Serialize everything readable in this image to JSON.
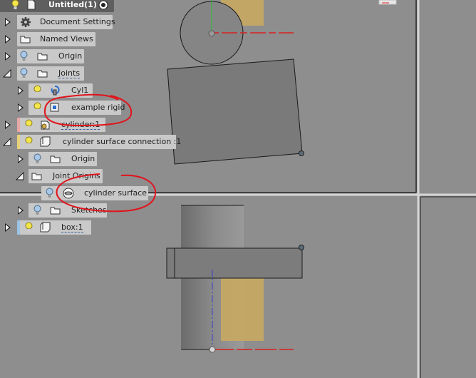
{
  "browser": {
    "root": {
      "label": "Untitled(1)"
    },
    "items": [
      {
        "label": "Document Settings"
      },
      {
        "label": "Named Views"
      },
      {
        "label": "Origin"
      },
      {
        "label": "Joints"
      },
      {
        "label": "Cyl1"
      },
      {
        "label": "example rigid"
      },
      {
        "label": "cylinder:1"
      },
      {
        "label": "cylinder surface connection :1"
      },
      {
        "label": "Origin"
      },
      {
        "label": "Joint Origins"
      },
      {
        "label": "cylinder surface"
      },
      {
        "label": "Sketches"
      },
      {
        "label": "box:1"
      }
    ]
  },
  "colors": {
    "viewport_bg": "#8e8e8e",
    "pill_bg": "#c9c9c9",
    "bulb": "#f2e64b",
    "annotation": "#e0141c",
    "body_face": "#7a7a7a",
    "wood": "#c8a862",
    "axis_red": "#d92020",
    "axis_green": "#2bbf36",
    "axis_blue": "#3a3ac8"
  }
}
